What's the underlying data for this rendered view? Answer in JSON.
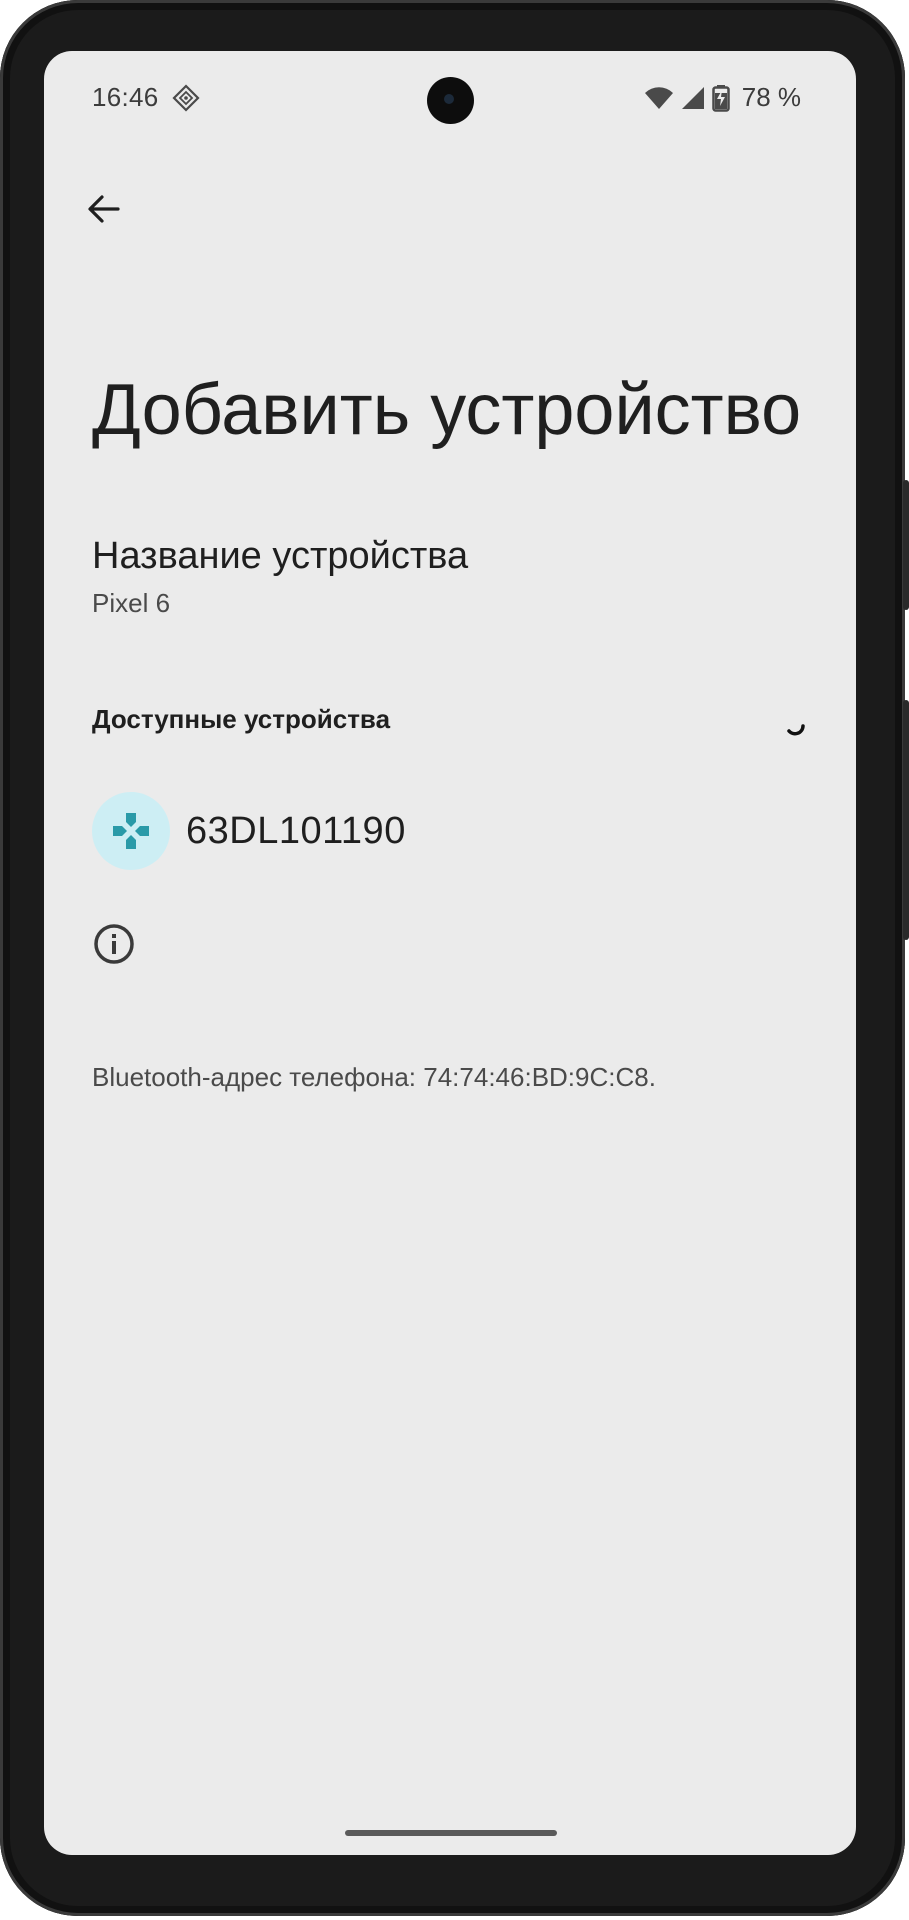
{
  "status_bar": {
    "time": "16:46",
    "battery_percent": "78 %",
    "icons": [
      "nfc-icon",
      "wifi-icon",
      "cellular-signal-icon",
      "battery-charging-icon"
    ]
  },
  "header": {
    "back_icon": "arrow-back-icon",
    "title": "Добавить устройство"
  },
  "device_name": {
    "title": "Название устройства",
    "value": "Pixel 6"
  },
  "available_devices": {
    "header": "Доступные устройства",
    "loading": true,
    "items": [
      {
        "label": "63DL101190",
        "icon": "gamepad-icon"
      }
    ]
  },
  "info": {
    "icon": "info-icon",
    "bluetooth_address": "Bluetooth-адрес телефона: 74:74:46:BD:9C:C8."
  },
  "colors": {
    "background": "#ebebeb",
    "device_icon_bg": "#cdeef4",
    "device_icon_fg": "#2a9aa8"
  }
}
